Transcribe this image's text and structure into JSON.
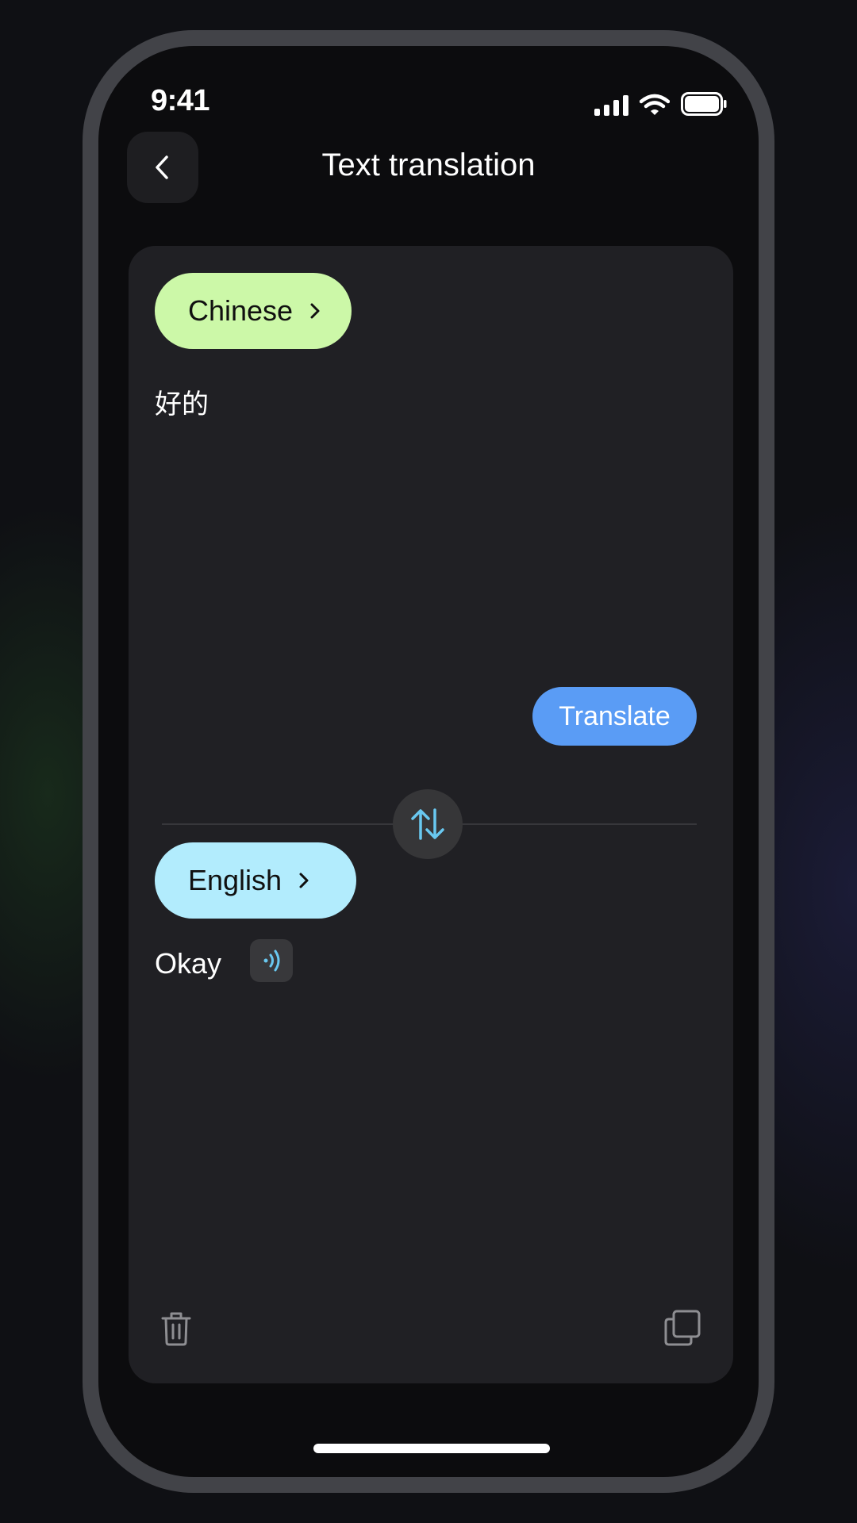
{
  "status_bar": {
    "time": "9:41",
    "icons": [
      "signal-icon",
      "wifi-icon",
      "battery-icon"
    ]
  },
  "header": {
    "title": "Text translation",
    "back_icon": "chevron-left-icon"
  },
  "source": {
    "language": "Chinese",
    "text": "好的",
    "pill_color": "#ccf8a8"
  },
  "translate_button": {
    "label": "Translate",
    "color": "#5a9cf5"
  },
  "swap": {
    "icon": "swap-vertical-icon",
    "accent": "#69c8f0"
  },
  "target": {
    "language": "English",
    "text": "Okay",
    "pill_color": "#b2ecfd",
    "speak_icon": "speaker-icon"
  },
  "footer_actions": {
    "delete_icon": "trash-icon",
    "copy_icon": "copy-icon"
  }
}
